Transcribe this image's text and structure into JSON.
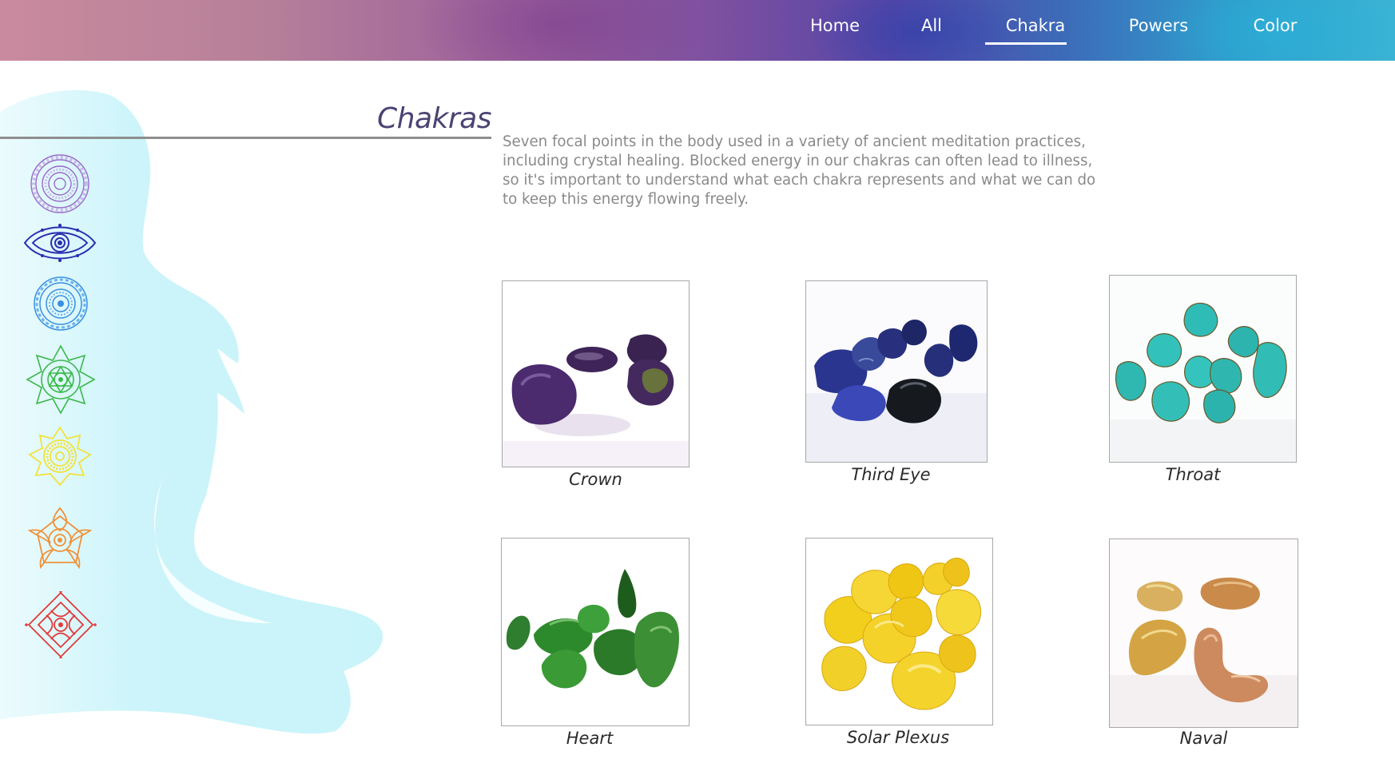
{
  "nav": {
    "items": [
      {
        "label": "Home"
      },
      {
        "label": "All"
      },
      {
        "label": "Chakra",
        "active": true
      },
      {
        "label": "Powers"
      },
      {
        "label": "Color"
      }
    ]
  },
  "page": {
    "title": "Chakras",
    "description": "Seven focal points in the body used in a variety of ancient meditation practices, including crystal healing. Blocked energy in our chakras can often lead to illness, so it's important to understand what each chakra represents and what we can do to keep this energy flowing freely."
  },
  "chakra_symbols": [
    {
      "name": "crown",
      "color": "#9a6bc9"
    },
    {
      "name": "third-eye",
      "color": "#2b2fb0"
    },
    {
      "name": "throat",
      "color": "#3a8fe0"
    },
    {
      "name": "heart",
      "color": "#3cb84a"
    },
    {
      "name": "solar-plexus",
      "color": "#f2e23a"
    },
    {
      "name": "sacral",
      "color": "#f0923a"
    },
    {
      "name": "root",
      "color": "#e23a3a"
    }
  ],
  "stones": [
    {
      "label": "Crown",
      "stone_color": "#4b2a6e"
    },
    {
      "label": "Third Eye",
      "stone_color": "#2a3590"
    },
    {
      "label": "Throat",
      "stone_color": "#2fbcb6"
    },
    {
      "label": "Heart",
      "stone_color": "#2f7d2e"
    },
    {
      "label": "Solar Plexus",
      "stone_color": "#f2cf1c"
    },
    {
      "label": "Naval",
      "stone_color": "#d9a05a"
    }
  ],
  "colors": {
    "title": "#4a4373",
    "description": "#8a8a8a",
    "silhouette": "#c9f4fa"
  }
}
